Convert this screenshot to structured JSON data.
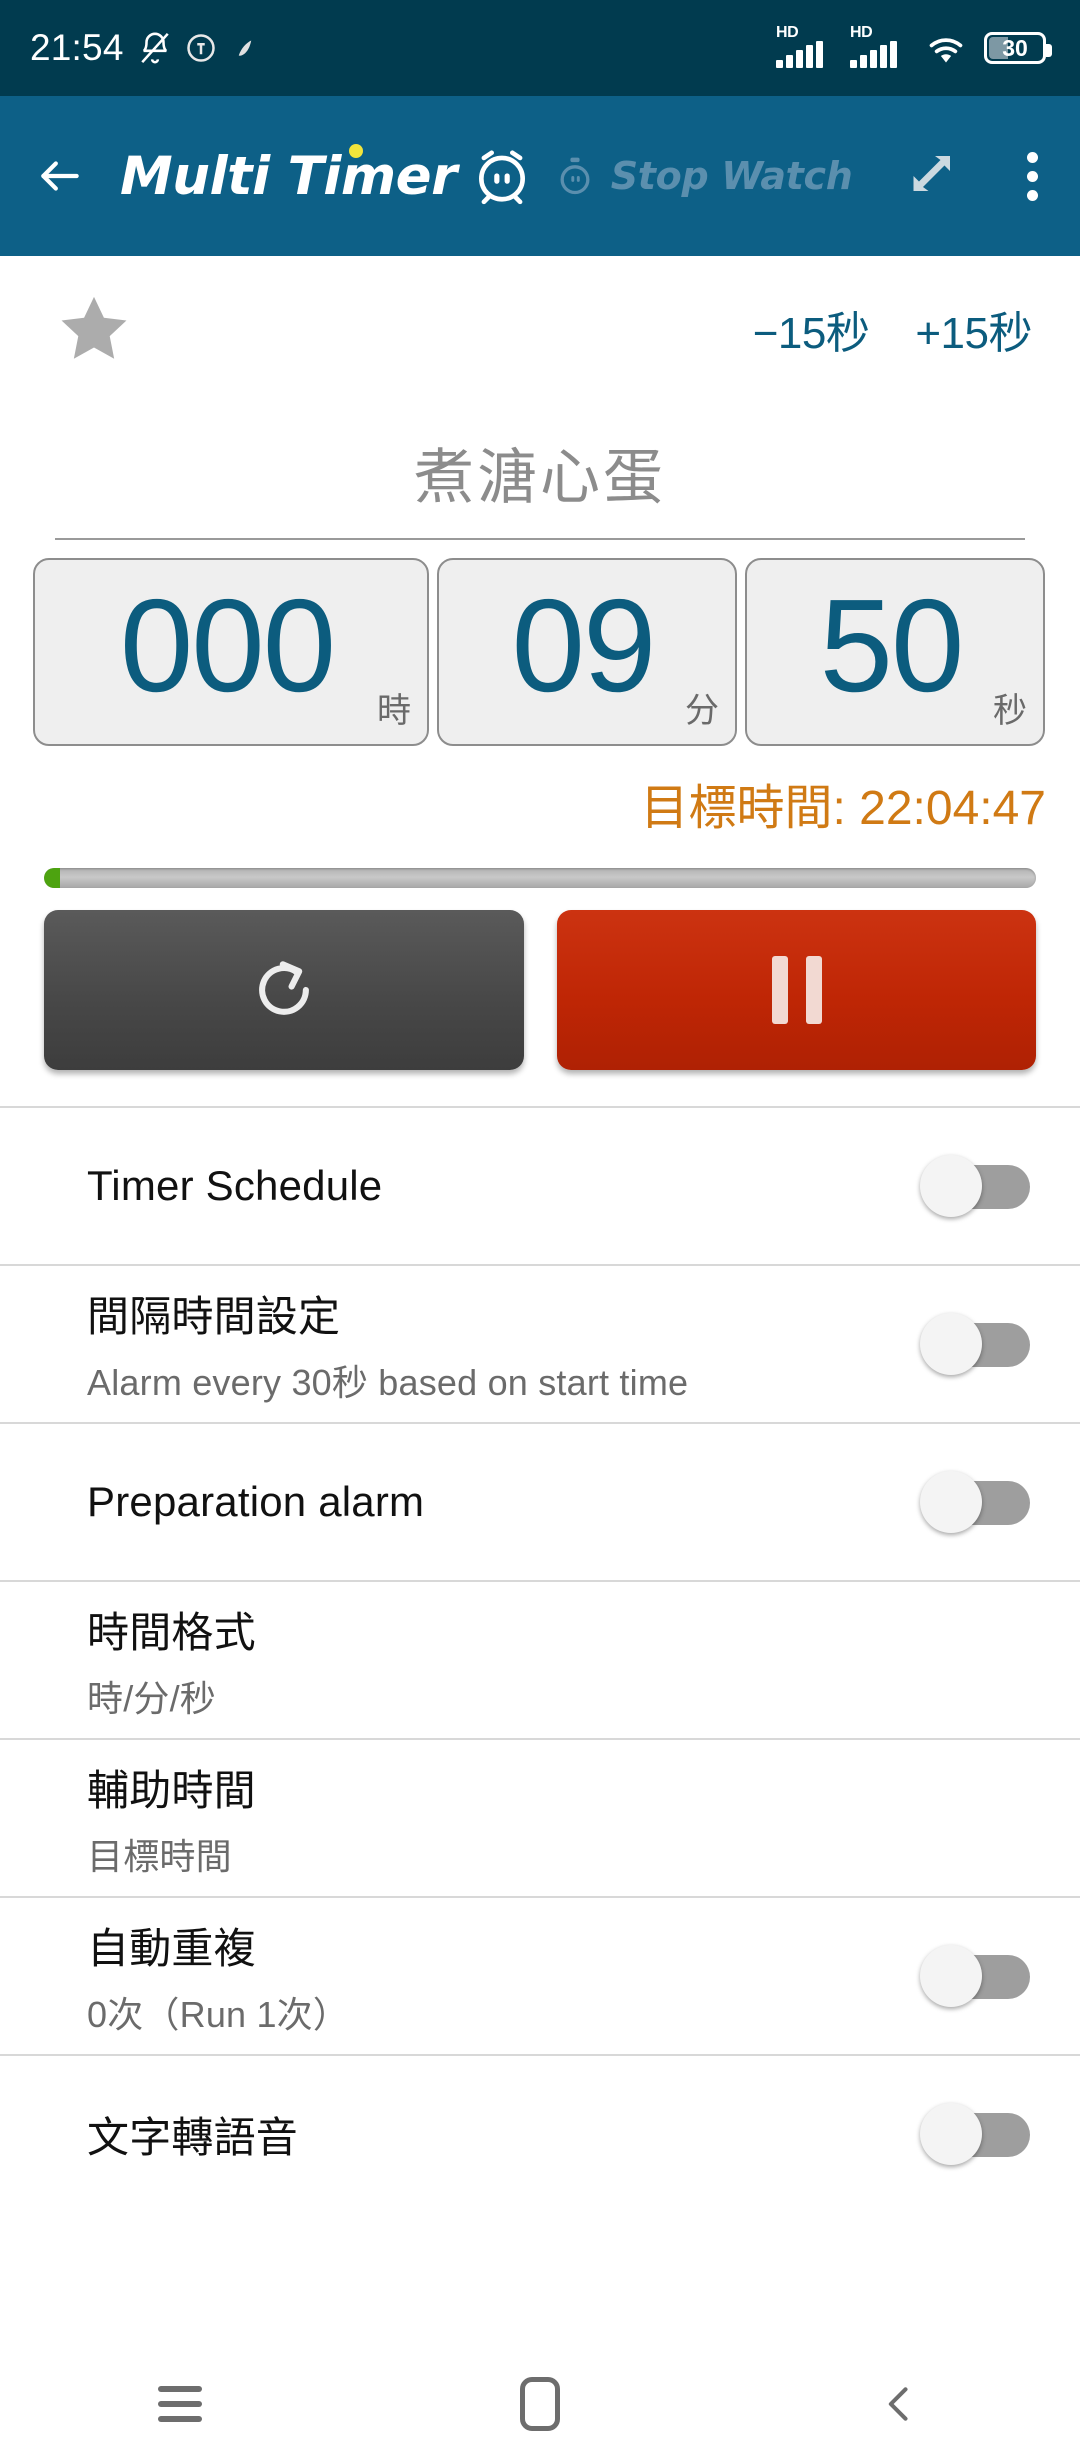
{
  "status_bar": {
    "clock": "21:54",
    "icons": [
      "bell-off-icon",
      "app-notification-icon",
      "app-notification-icon-2"
    ],
    "signal_label": "HD",
    "signal_label_2": "HD",
    "wifi": "wifi-icon",
    "battery_level": "30"
  },
  "app_bar": {
    "back": "back-arrow-icon",
    "title": "Multi Timer",
    "title_icon": "alarm-clock-icon",
    "secondary_tab": "Stop Watch",
    "secondary_icon": "stopwatch-icon",
    "expand": "expand-arrows-icon",
    "overflow": "overflow-menu-icon"
  },
  "timer": {
    "favorite_icon": "star-icon",
    "decrease_label": "−15秒",
    "increase_label": "+15秒",
    "name": "煮溏心蛋",
    "hours": "000",
    "hours_unit": "時",
    "minutes": "09",
    "minutes_unit": "分",
    "seconds": "50",
    "seconds_unit": "秒",
    "target_time": "目標時間: 22:04:47",
    "progress_percent": 1.6,
    "reset_icon": "reset-circular-arrow-icon",
    "pause_icon": "pause-icon",
    "accent_color": "#0C5C7E",
    "target_color": "#D07A14",
    "pause_color": "#BF2605",
    "reset_color": "#484848",
    "progress_color": "#4DA310"
  },
  "settings": [
    {
      "title": "Timer Schedule",
      "sub": "",
      "toggle": true,
      "toggle_on": false
    },
    {
      "title": "間隔時間設定",
      "sub": "Alarm every 30秒 based on start time",
      "toggle": true,
      "toggle_on": false
    },
    {
      "title": "Preparation alarm",
      "sub": "",
      "toggle": true,
      "toggle_on": false
    },
    {
      "title": "時間格式",
      "sub": "時/分/秒",
      "toggle": false,
      "toggle_on": false
    },
    {
      "title": "輔助時間",
      "sub": "目標時間",
      "toggle": false,
      "toggle_on": false
    },
    {
      "title": "自動重複",
      "sub": "0次（Run 1次）",
      "toggle": true,
      "toggle_on": false
    },
    {
      "title": "文字轉語音",
      "sub": "",
      "toggle": true,
      "toggle_on": false
    }
  ],
  "nav_bar": {
    "recents": "recents-icon",
    "home": "home-icon",
    "back": "back-icon"
  }
}
